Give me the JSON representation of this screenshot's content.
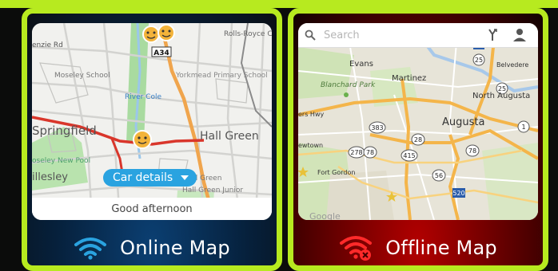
{
  "online": {
    "label": "Online Map",
    "car_details": "Car details",
    "greeting": "Good afternoon",
    "place_labels": {
      "kenzie_rd": "enzie Rd",
      "a34": "A34",
      "rolls_royce": "Rolls-Royce Control Syste",
      "moseley_school": "Moseley School",
      "yorkmead": "Yorkmead Primary School",
      "river_cole": "River Cole",
      "springfield": "Springfield",
      "hall_green": "Hall Green",
      "hall_green_small": "Hall Green",
      "hall_green_junior": "Hall Green Junior",
      "moseley_new_pool": "oseley New Pool",
      "illesley": "illesley"
    }
  },
  "offline": {
    "label": "Offline Map",
    "search_placeholder": "Search",
    "place_labels": {
      "evans": "Evans",
      "blanchard_park": "Blanchard Park",
      "martinez": "Martinez",
      "belvedere": "Belvedere",
      "north_augusta": "North Augusta",
      "augusta": "Augusta",
      "ers_hwy": "ers Hwy",
      "fort_gordon": "Fort Gordon",
      "ewtown": "ewtown",
      "google": "Google"
    },
    "route_shields": [
      "121",
      "25",
      "20",
      "383",
      "28",
      "78",
      "278",
      "78",
      "415",
      "56",
      "520",
      "25",
      "1"
    ]
  },
  "colors": {
    "frame": "#b7ea1f",
    "online_wifi": "#2aa3e0",
    "offline_wifi": "#ff2a2a",
    "car_details": "#2aa3e0"
  },
  "icons": {
    "online": "wifi-icon",
    "offline": "wifi-off-icon",
    "search": "search-icon",
    "route": "route-icon",
    "profile": "person-icon"
  }
}
